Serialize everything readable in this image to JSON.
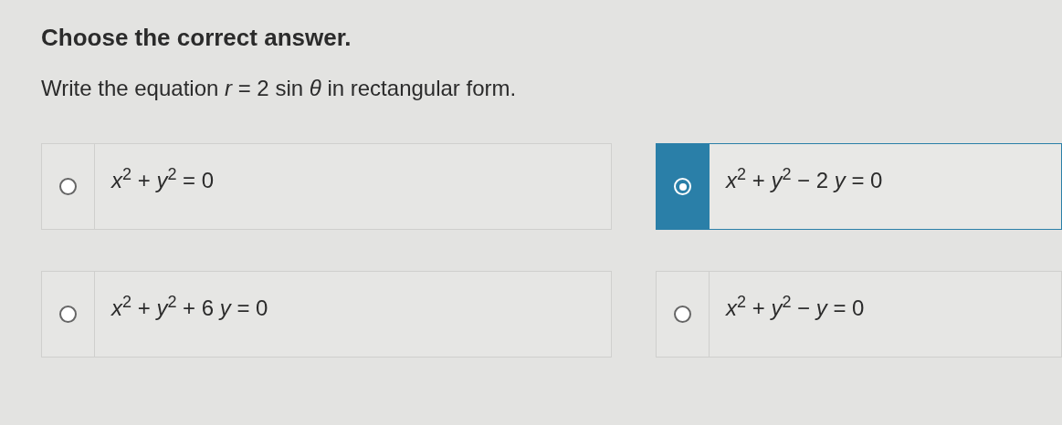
{
  "title": "Choose the correct answer.",
  "question": "Write the equation *r* = 2 sin *θ* in rectangular form.",
  "options": [
    {
      "label": "*x*$^{2}$ + *y*$^{2}$ = 0",
      "selected": false
    },
    {
      "label": "*x*$^{2}$ + *y*$^{2}$ − 2 *y* = 0",
      "selected": true
    },
    {
      "label": "*x*$^{2}$ + *y*$^{2}$ + 6 *y* = 0",
      "selected": false
    },
    {
      "label": "*x*$^{2}$ + *y*$^{2}$ − *y* = 0",
      "selected": false
    }
  ]
}
